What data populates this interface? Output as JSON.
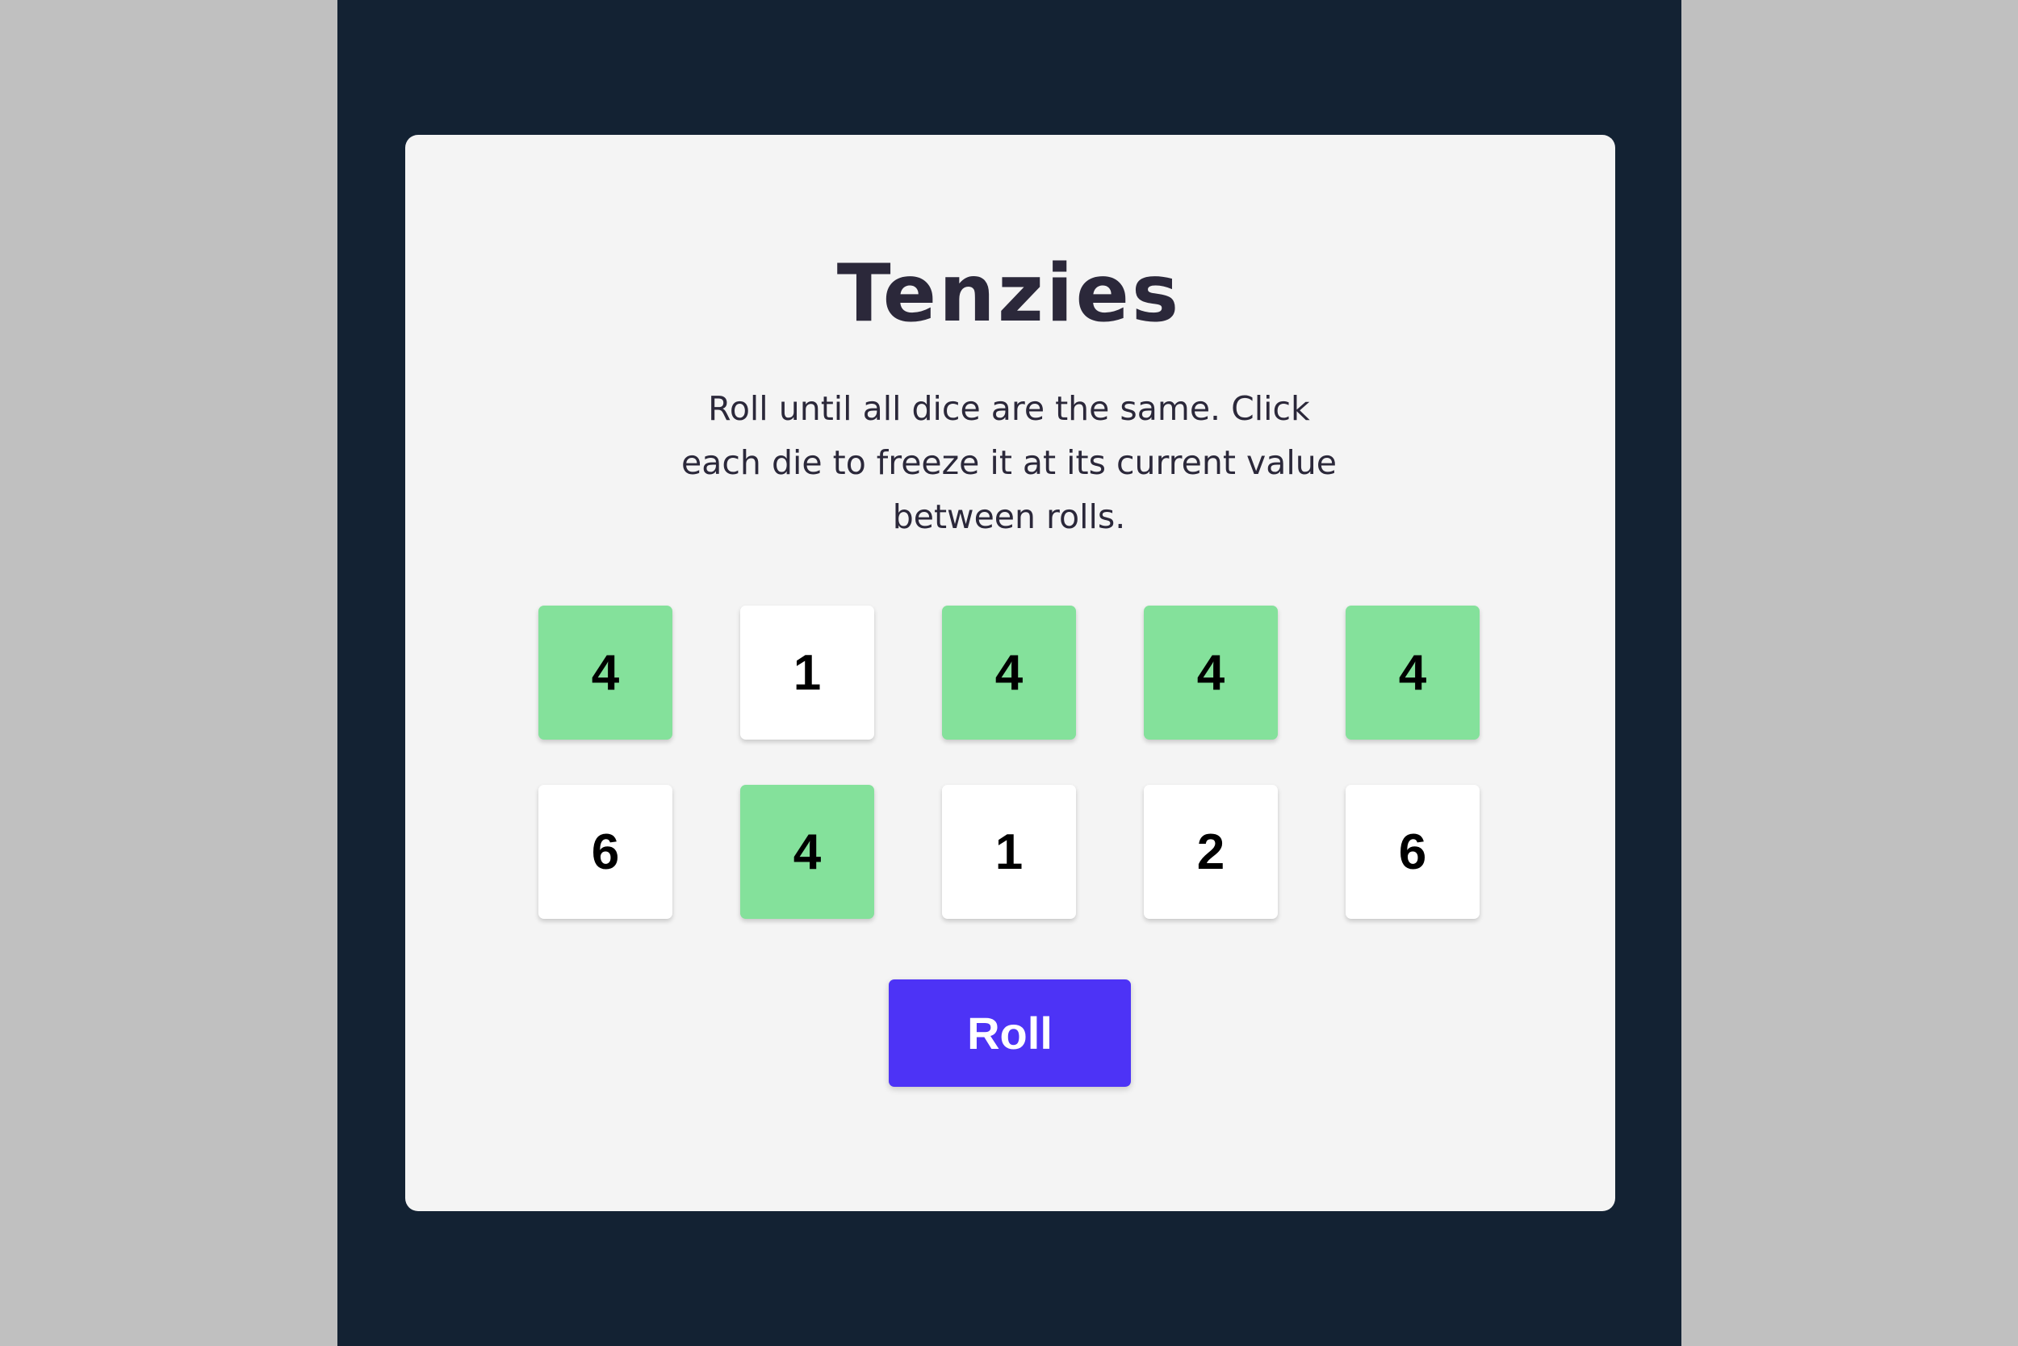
{
  "game": {
    "title": "Tenzies",
    "instructions": "Roll until all dice are the same. Click each die to freeze it at its current value between rolls.",
    "roll_label": "Roll"
  },
  "dice": [
    {
      "value": "4",
      "held": true
    },
    {
      "value": "1",
      "held": false
    },
    {
      "value": "4",
      "held": true
    },
    {
      "value": "4",
      "held": true
    },
    {
      "value": "4",
      "held": true
    },
    {
      "value": "6",
      "held": false
    },
    {
      "value": "4",
      "held": true
    },
    {
      "value": "1",
      "held": false
    },
    {
      "value": "2",
      "held": false
    },
    {
      "value": "6",
      "held": false
    }
  ],
  "colors": {
    "page_background": "#c0c0c0",
    "stage_background": "#132233",
    "card_background": "#f4f4f4",
    "held_die": "#84e19b",
    "free_die": "#ffffff",
    "roll_button": "#4d33f6",
    "text": "#2b283a"
  }
}
